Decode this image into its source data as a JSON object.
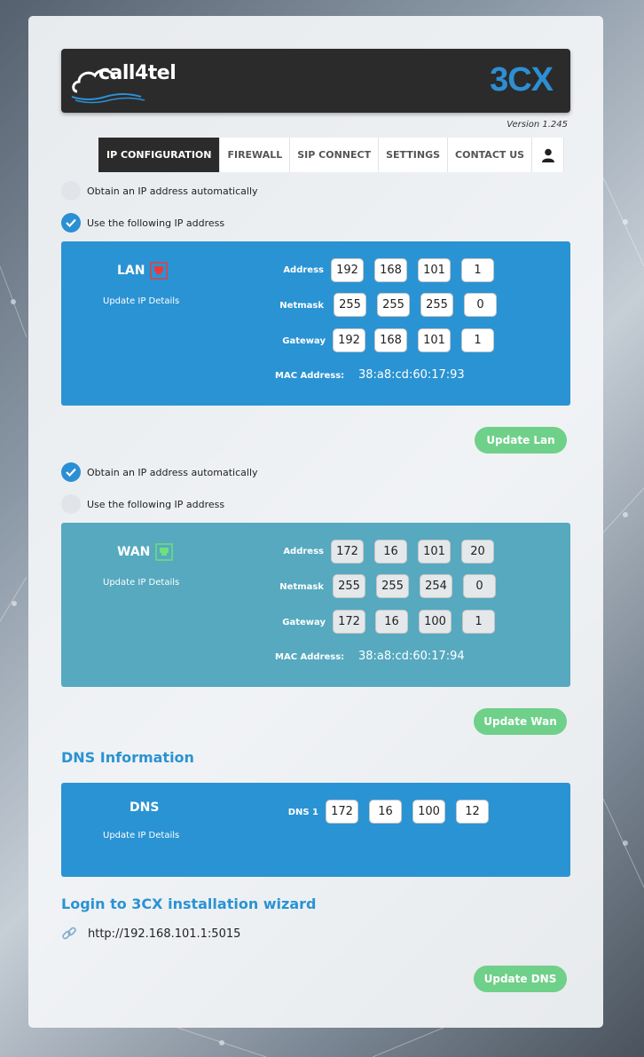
{
  "brand": {
    "left_logo": "call4tel",
    "right_logo": "3CX"
  },
  "version": "Version 1.245",
  "tabs": [
    {
      "label": "IP CONFIGURATION",
      "active": true
    },
    {
      "label": "FIREWALL"
    },
    {
      "label": "SIP CONNECT"
    },
    {
      "label": "SETTINGS"
    },
    {
      "label": "CONTACT US"
    }
  ],
  "user_icon": "user-icon",
  "lan": {
    "auto_label": "Obtain an IP address automatically",
    "auto_checked": false,
    "manual_label": "Use the following IP address",
    "manual_checked": true,
    "title": "LAN",
    "port_status_color": "#e63c3c",
    "update_link": "Update IP Details",
    "address_label": "Address",
    "address": [
      "192",
      "168",
      "101",
      "1"
    ],
    "netmask_label": "Netmask",
    "netmask": [
      "255",
      "255",
      "255",
      "0"
    ],
    "gateway_label": "Gateway",
    "gateway": [
      "192",
      "168",
      "101",
      "1"
    ],
    "mac_label": "MAC Address:",
    "mac": "38:a8:cd:60:17:93",
    "button": "Update Lan"
  },
  "wan": {
    "auto_label": "Obtain an IP address automatically",
    "auto_checked": true,
    "manual_label": "Use the following IP address",
    "manual_checked": false,
    "title": "WAN",
    "port_status_color": "#6fe07a",
    "update_link": "Update IP Details",
    "address_label": "Address",
    "address": [
      "172",
      "16",
      "101",
      "20"
    ],
    "netmask_label": "Netmask",
    "netmask": [
      "255",
      "255",
      "254",
      "0"
    ],
    "gateway_label": "Gateway",
    "gateway": [
      "172",
      "16",
      "100",
      "1"
    ],
    "mac_label": "MAC Address:",
    "mac": "38:a8:cd:60:17:94",
    "button": "Update Wan"
  },
  "dns": {
    "heading": "DNS Information",
    "title": "DNS",
    "update_link": "Update IP Details",
    "dns1_label": "DNS 1",
    "dns1": [
      "172",
      "16",
      "100",
      "12"
    ]
  },
  "wizard": {
    "heading": "Login to 3CX installation wizard",
    "link_icon": "link-icon",
    "url": "http://192.168.101.1:5015",
    "button": "Update DNS"
  },
  "colors": {
    "accent_blue": "#2a93d3",
    "wan_teal": "#56a9bf",
    "button_green": "#6fd089",
    "header_dark": "#2b2b2b"
  }
}
